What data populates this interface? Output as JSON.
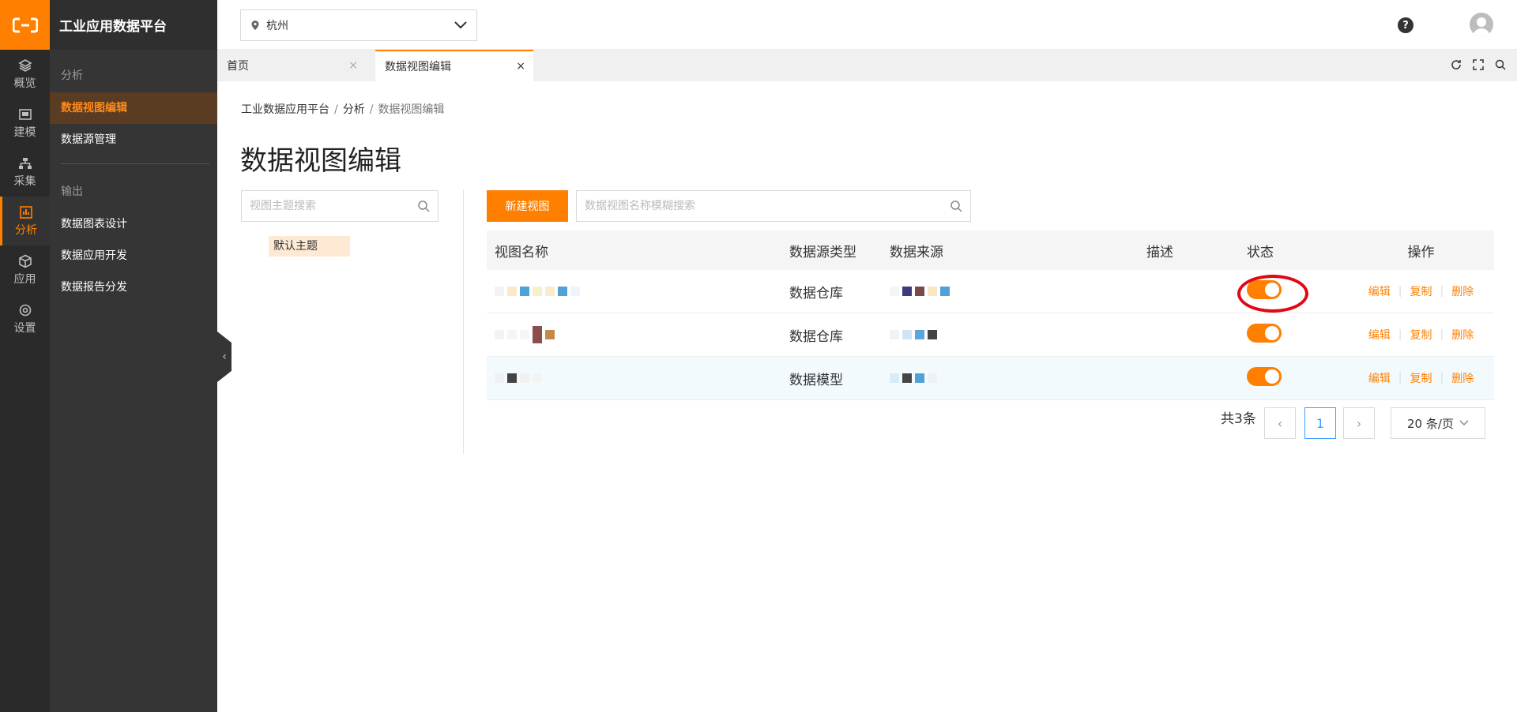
{
  "app": {
    "title": "工业应用数据平台"
  },
  "rail": [
    {
      "id": "overview",
      "label": "概览",
      "icon": "layers-icon"
    },
    {
      "id": "modeling",
      "label": "建模",
      "icon": "dashboard-icon"
    },
    {
      "id": "collect",
      "label": "采集",
      "icon": "sitemap-icon"
    },
    {
      "id": "analysis",
      "label": "分析",
      "icon": "bar-chart-icon",
      "active": true
    },
    {
      "id": "apps",
      "label": "应用",
      "icon": "cube-icon"
    },
    {
      "id": "settings",
      "label": "设置",
      "icon": "gear-icon"
    }
  ],
  "panel": {
    "group1": "分析",
    "item1": "数据视图编辑",
    "item2": "数据源管理",
    "group2": "输出",
    "item3": "数据图表设计",
    "item4": "数据应用开发",
    "item5": "数据报告分发"
  },
  "top": {
    "city": "杭州",
    "help": "?"
  },
  "tabs": [
    {
      "label": "首页"
    },
    {
      "label": "数据视图编辑",
      "active": true
    }
  ],
  "breadcrumb": {
    "a": "工业数据应用平台",
    "b": "分析",
    "c": "数据视图编辑"
  },
  "page_title": "数据视图编辑",
  "theme_search": {
    "placeholder": "视图主题搜索"
  },
  "theme_item": "默认主题",
  "new_view_label": "新建视图",
  "view_search": {
    "placeholder": "数据视图名称模糊搜索"
  },
  "table": {
    "headers": {
      "name": "视图名称",
      "type": "数据源类型",
      "source": "数据来源",
      "desc": "描述",
      "status": "状态",
      "ops": "操作"
    },
    "rows": [
      {
        "type": "数据仓库",
        "enabled": true
      },
      {
        "type": "数据仓库",
        "enabled": true
      },
      {
        "type": "数据模型",
        "enabled": true
      }
    ],
    "ops": {
      "edit": "编辑",
      "copy": "复制",
      "delete": "删除"
    }
  },
  "pager": {
    "total": "共3条",
    "current": "1",
    "size": "20 条/页"
  },
  "colors": {
    "accent": "#ff8000",
    "highlight_ring": "#e30613"
  }
}
